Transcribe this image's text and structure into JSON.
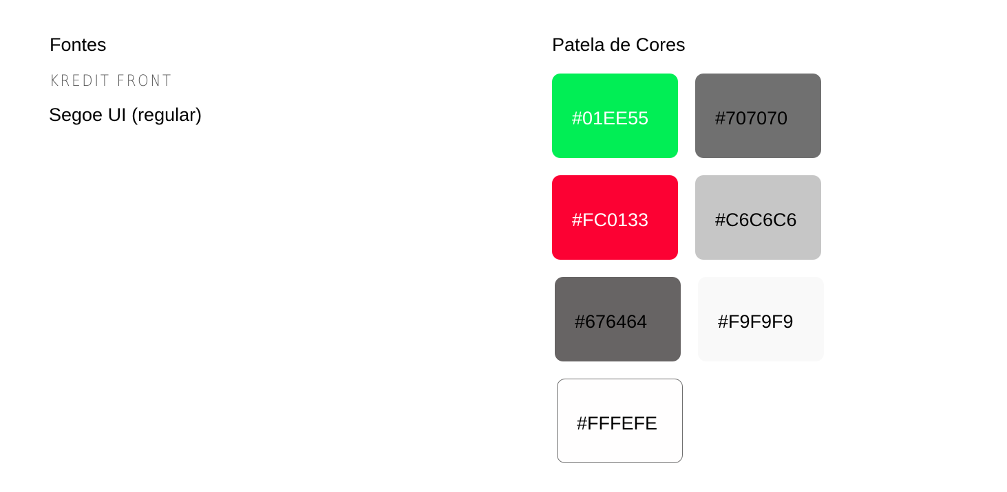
{
  "fonts": {
    "title": "Fontes",
    "items": [
      "KREDIT FRONT",
      "Segoe UI (regular)"
    ]
  },
  "palette": {
    "title": "Patela de Cores",
    "colors": [
      {
        "hex": "#01EE55",
        "label": "#01EE55",
        "text_color": "#FFFFFF"
      },
      {
        "hex": "#707070",
        "label": "#707070",
        "text_color": "#000000"
      },
      {
        "hex": "#FC0133",
        "label": "#FC0133",
        "text_color": "#FFFFFF"
      },
      {
        "hex": "#C6C6C6",
        "label": "#C6C6C6",
        "text_color": "#000000"
      },
      {
        "hex": "#676464",
        "label": "#676464",
        "text_color": "#000000"
      },
      {
        "hex": "#F9F9F9",
        "label": "#F9F9F9",
        "text_color": "#000000"
      },
      {
        "hex": "#FFFEFE",
        "label": "#FFFEFE",
        "text_color": "#000000"
      }
    ]
  }
}
